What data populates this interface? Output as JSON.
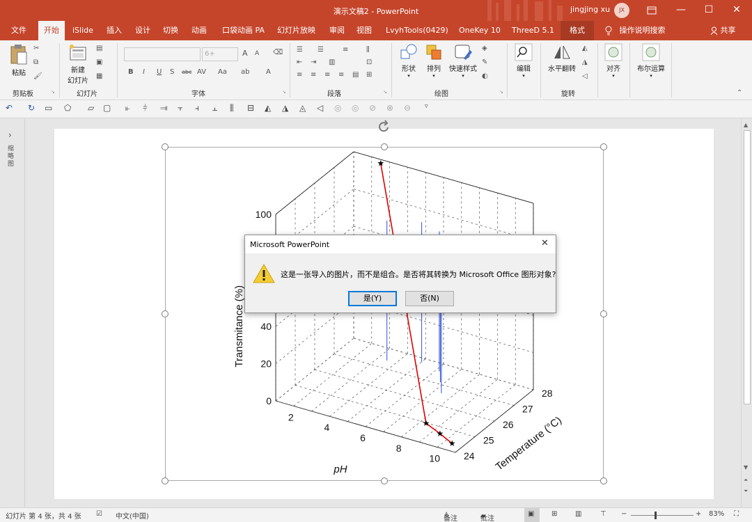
{
  "window": {
    "title": "演示文稿2  -  PowerPoint",
    "user": "jingjing xu",
    "avatar": "JX",
    "controls": {
      "ribbon_display": "ribbon-display-icon",
      "minimize": "—",
      "maximize": "☐",
      "close": "✕"
    }
  },
  "tabs": [
    "文件",
    "开始",
    "iSlide",
    "插入",
    "设计",
    "切换",
    "动画",
    "口袋动画 PA",
    "幻灯片放映",
    "审阅",
    "视图",
    "LvyhTools(0429)",
    "OneKey 10",
    "ThreeD 5.1",
    "格式"
  ],
  "tell_me": "操作说明搜索",
  "share": "共享",
  "ribbon": {
    "clipboard": {
      "paste": "粘贴",
      "label": "剪贴板"
    },
    "slides": {
      "new_slide_1": "新建",
      "new_slide_2": "幻灯片",
      "label": "幻灯片"
    },
    "font": {
      "size_placeholder": "6+",
      "bold": "B",
      "italic": "I",
      "underline": "U",
      "shadow": "S",
      "strike": "abc",
      "spacing": "AV",
      "case": "Aa",
      "grow": "A",
      "shrink": "A",
      "label": "字体"
    },
    "paragraph": {
      "label": "段落"
    },
    "drawing": {
      "shapes": "形状",
      "arrange": "排列",
      "quick_styles": "快速样式",
      "label": "绘图"
    },
    "editing": {
      "edit": "编辑"
    },
    "rotate": {
      "flip": "水平翻转",
      "label": "旋转"
    },
    "align": {
      "label": "对齐"
    },
    "boolean": {
      "label": "布尔运算"
    }
  },
  "left_pane": {
    "label": "缩略图"
  },
  "chart_data": {
    "type": "scatter",
    "title": "",
    "xlabel": "pH",
    "ylabel": "Temperature (°C)",
    "zlabel": "Transmitance (%)",
    "x_ticks": [
      "2",
      "4",
      "6",
      "8",
      "10"
    ],
    "y_ticks": [
      "24",
      "25",
      "26",
      "27",
      "28"
    ],
    "z_ticks": [
      "0",
      "20",
      "40",
      "100"
    ],
    "xlim": [
      1,
      11
    ],
    "ylim": [
      24,
      28
    ],
    "zlim": [
      0,
      100
    ],
    "grid": true,
    "series": [
      {
        "color": "#e00000",
        "marker": "star",
        "points": [
          {
            "x": 2.5,
            "y": 28,
            "z": 98
          },
          {
            "x": 8.5,
            "y": 24.8,
            "z": 2
          },
          {
            "x": 9.6,
            "y": 24.5,
            "z": 2
          },
          {
            "x": 10.6,
            "y": 24.2,
            "z": 2
          }
        ]
      }
    ]
  },
  "dialog": {
    "title": "Microsoft PowerPoint",
    "message": "这是一张导入的图片，而不是组合。是否将其转换为 Microsoft Office 图形对象?",
    "yes": "是(Y)",
    "no": "否(N)"
  },
  "status": {
    "slide_info": "幻灯片 第 4 张，共 4 张",
    "language": "中文(中国)",
    "notes": "备注",
    "comments": "批注",
    "zoom": "83%"
  },
  "colors": {
    "accent": "#c5452b",
    "accent_dark": "#a83a24",
    "ribbon_bg": "#f3f3f3",
    "chart_series": "#e00000",
    "chart_stem": "#3050e0"
  }
}
